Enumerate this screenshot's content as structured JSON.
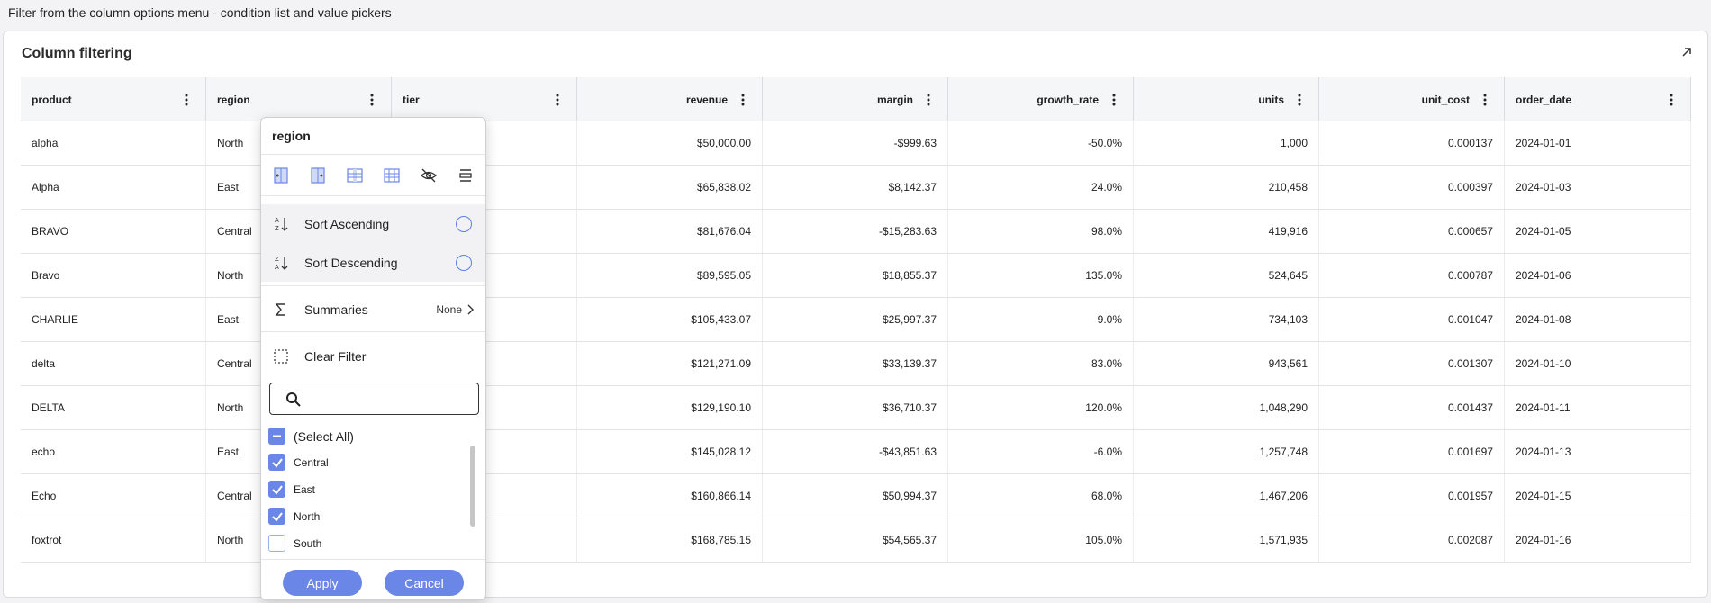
{
  "caption": "Filter from the column options menu - condition list and value pickers",
  "card": {
    "title": "Column filtering",
    "expand_icon": "expand-arrow-icon"
  },
  "columns": [
    {
      "key": "product",
      "label": "product",
      "align": "left"
    },
    {
      "key": "region",
      "label": "region",
      "align": "left"
    },
    {
      "key": "tier",
      "label": "tier",
      "align": "left"
    },
    {
      "key": "revenue",
      "label": "revenue",
      "align": "right"
    },
    {
      "key": "margin",
      "label": "margin",
      "align": "right"
    },
    {
      "key": "growth_rate",
      "label": "growth_rate",
      "align": "right"
    },
    {
      "key": "units",
      "label": "units",
      "align": "right"
    },
    {
      "key": "unit_cost",
      "label": "unit_cost",
      "align": "right"
    },
    {
      "key": "order_date",
      "label": "order_date",
      "align": "left"
    }
  ],
  "rows": [
    [
      "alpha",
      "North",
      "",
      "$50,000.00",
      "-$999.63",
      "-50.0%",
      "1,000",
      "0.000137",
      "2024-01-01"
    ],
    [
      "Alpha",
      "East",
      "",
      "$65,838.02",
      "$8,142.37",
      "24.0%",
      "210,458",
      "0.000397",
      "2024-01-03"
    ],
    [
      "BRAVO",
      "Central",
      "",
      "$81,676.04",
      "-$15,283.63",
      "98.0%",
      "419,916",
      "0.000657",
      "2024-01-05"
    ],
    [
      "Bravo",
      "North",
      "",
      "$89,595.05",
      "$18,855.37",
      "135.0%",
      "524,645",
      "0.000787",
      "2024-01-06"
    ],
    [
      "CHARLIE",
      "East",
      "",
      "$105,433.07",
      "$25,997.37",
      "9.0%",
      "734,103",
      "0.001047",
      "2024-01-08"
    ],
    [
      "delta",
      "Central",
      "",
      "$121,271.09",
      "$33,139.37",
      "83.0%",
      "943,561",
      "0.001307",
      "2024-01-10"
    ],
    [
      "DELTA",
      "North",
      "",
      "$129,190.10",
      "$36,710.37",
      "120.0%",
      "1,048,290",
      "0.001437",
      "2024-01-11"
    ],
    [
      "echo",
      "East",
      "",
      "$145,028.12",
      "-$43,851.63",
      "-6.0%",
      "1,257,748",
      "0.001697",
      "2024-01-13"
    ],
    [
      "Echo",
      "Central",
      "",
      "$160,866.14",
      "$50,994.37",
      "68.0%",
      "1,467,206",
      "0.001957",
      "2024-01-15"
    ],
    [
      "foxtrot",
      "North",
      "",
      "$168,785.15",
      "$54,565.37",
      "105.0%",
      "1,571,935",
      "0.002087",
      "2024-01-16"
    ]
  ],
  "menu": {
    "title": "region",
    "tools": [
      "pin-left-icon",
      "pin-right-icon",
      "select-column-icon",
      "autosize-icon",
      "hide-column-icon",
      "group-icon"
    ],
    "sort_asc": "Sort Ascending",
    "sort_desc": "Sort Descending",
    "summaries": "Summaries",
    "summaries_value": "None",
    "clear_filter": "Clear Filter",
    "search_placeholder": "",
    "select_all": "(Select All)",
    "values": [
      {
        "label": "Central",
        "checked": true
      },
      {
        "label": "East",
        "checked": true
      },
      {
        "label": "North",
        "checked": true
      },
      {
        "label": "South",
        "checked": false
      }
    ],
    "apply": "Apply",
    "cancel": "Cancel"
  },
  "colors": {
    "accent": "#6a86e6",
    "header_bg": "#f5f6f8"
  }
}
